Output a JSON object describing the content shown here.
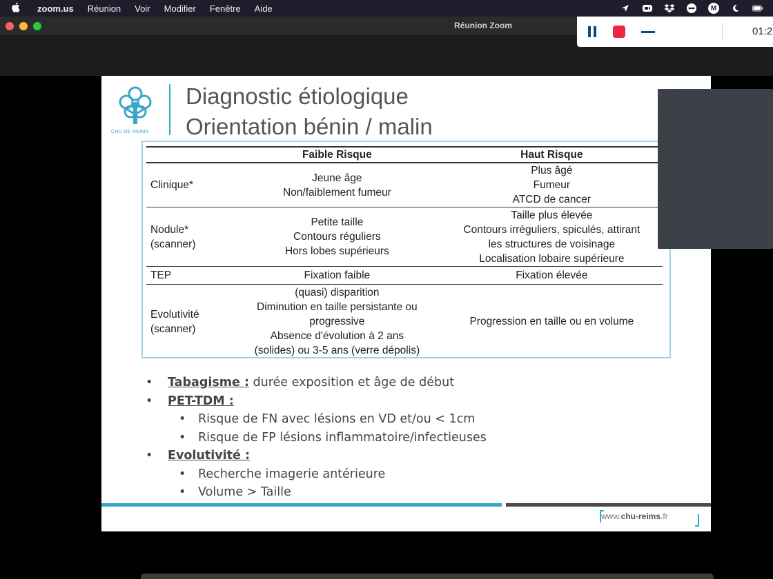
{
  "menubar": {
    "apple_glyph": "",
    "app_name": "zoom.us",
    "items": [
      "Réunion",
      "Voir",
      "Modifier",
      "Fenêtre",
      "Aide"
    ]
  },
  "window": {
    "title": "Réunion Zoom"
  },
  "recording": {
    "time": "01:2"
  },
  "slide": {
    "logo_caption": "CHU DE REIMS",
    "title_line1": "Diagnostic étiologique",
    "title_line2": "Orientation bénin / malin",
    "table": {
      "headers": [
        "",
        "Faible Risque",
        "Haut Risque"
      ],
      "rows": [
        {
          "label": [
            "Clinique*"
          ],
          "low": [
            "Jeune âge",
            "Non/faiblement fumeur"
          ],
          "high": [
            "Plus âgé",
            "Fumeur",
            "ATCD de cancer"
          ]
        },
        {
          "label": [
            "Nodule*",
            "(scanner)"
          ],
          "low": [
            "Petite taille",
            "Contours réguliers",
            "Hors lobes supérieurs"
          ],
          "high": [
            "Taille plus élevée",
            "Contours irréguliers, spiculés, attirant",
            "les structures de voisinage",
            "Localisation lobaire supérieure"
          ]
        },
        {
          "label": [
            "TEP"
          ],
          "low": [
            "Fixation faible"
          ],
          "high": [
            "Fixation élevée"
          ]
        },
        {
          "label": [
            "Evolutivité",
            "(scanner)"
          ],
          "low": [
            "(quasi) disparition",
            "Diminution en taille persistante ou",
            "progressive",
            "Absence d'évolution à 2 ans",
            "(solides) ou 3-5 ans (verre dépolis)"
          ],
          "high": [
            "Progression en taille ou en volume"
          ]
        }
      ]
    },
    "bullets": [
      {
        "level": 1,
        "bold": "Tabagisme :",
        "text": " durée exposition et âge de début"
      },
      {
        "level": 1,
        "bold": "PET-TDM :",
        "text": ""
      },
      {
        "level": 2,
        "bold": "",
        "text": "Risque de FN avec lésions en VD et/ou < 1cm"
      },
      {
        "level": 2,
        "bold": "",
        "text": "Risque de FP lésions inflammatoire/infectieuses"
      },
      {
        "level": 1,
        "bold": "Evolutivité :",
        "text": ""
      },
      {
        "level": 2,
        "bold": "",
        "text": "Recherche imagerie antérieure"
      },
      {
        "level": 2,
        "bold": "",
        "text": "Volume > Taille"
      }
    ],
    "bullet_glyph": "•",
    "footer_url_prefix": "www.",
    "footer_url_main": "chu-reims",
    "footer_url_suffix": ".fr"
  },
  "colors": {
    "accent_blue": "#3aa6c8",
    "record_red": "#e8293b",
    "zoom_navy": "#0b4a6e"
  }
}
